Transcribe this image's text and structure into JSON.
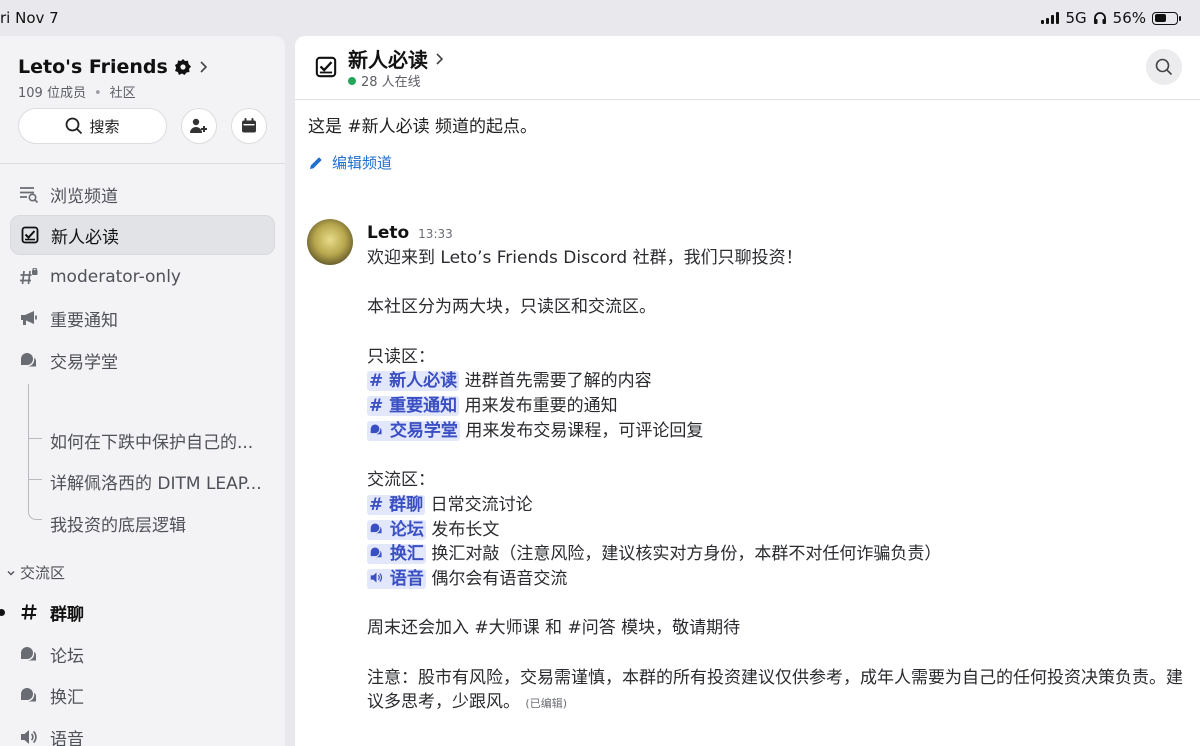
{
  "status_bar": {
    "time": "ri Nov 7",
    "network": "5G",
    "battery": "56%",
    "battery_level": 0.56
  },
  "server": {
    "name": "Leto's Friends",
    "members": "109 位成员",
    "type": "社区",
    "search_label": "搜索"
  },
  "sidebar": {
    "browse": "浏览频道",
    "items": [
      {
        "label": "新人必读",
        "icon": "rules-icon"
      },
      {
        "label": "moderator-only",
        "icon": "locked-hash-icon"
      },
      {
        "label": "重要通知",
        "icon": "megaphone-icon"
      },
      {
        "label": "交易学堂",
        "icon": "forum-icon"
      }
    ],
    "threads": [
      "如何在下跌中保护自己的...",
      "详解佩洛西的 DITM LEAP...",
      "我投资的底层逻辑"
    ],
    "category": "交流区",
    "category_items": [
      {
        "label": "群聊",
        "icon": "hash-icon"
      },
      {
        "label": "论坛",
        "icon": "forum-icon"
      },
      {
        "label": "换汇",
        "icon": "forum-icon"
      },
      {
        "label": "语音",
        "icon": "speaker-icon"
      }
    ]
  },
  "channel": {
    "title": "新人必读",
    "online": "28 人在线",
    "intro": "这是 #新人必读 频道的起点。",
    "edit": "编辑频道"
  },
  "message": {
    "author": "Leto",
    "time": "13:33",
    "line1": "欢迎来到 Leto’s Friends Discord 社群，我们只聊投资！",
    "line2": "本社区分为两大块，只读区和交流区。",
    "readonly_title": "只读区：",
    "ro1_tag": "# 新人必读",
    "ro1_text": " 进群首先需要了解的内容",
    "ro2_tag": "# 重要通知",
    "ro2_text": " 用来发布重要的通知",
    "ro3_tag": "交易学堂",
    "ro3_text": " 用来发布交易课程，可评论回复",
    "chat_title": "交流区：",
    "c1_tag": "# 群聊",
    "c1_text": " 日常交流讨论",
    "c2_tag": "论坛",
    "c2_text": " 发布长文",
    "c3_tag": "换汇",
    "c3_text": " 换汇对敲（注意风险，建议核实对方身份，本群不对任何诈骗负责）",
    "c4_tag": "语音",
    "c4_text": " 偶尔会有语音交流",
    "weekend": "周末还会加入 #大师课 和 #问答 模块，敬请期待",
    "notice": "注意：股市有风险，交易需谨慎，本群的所有投资建议仅供参考，成年人需要为自己的任何投资决策负责。建议多思考，少跟风。",
    "edited": "(已编辑)"
  }
}
